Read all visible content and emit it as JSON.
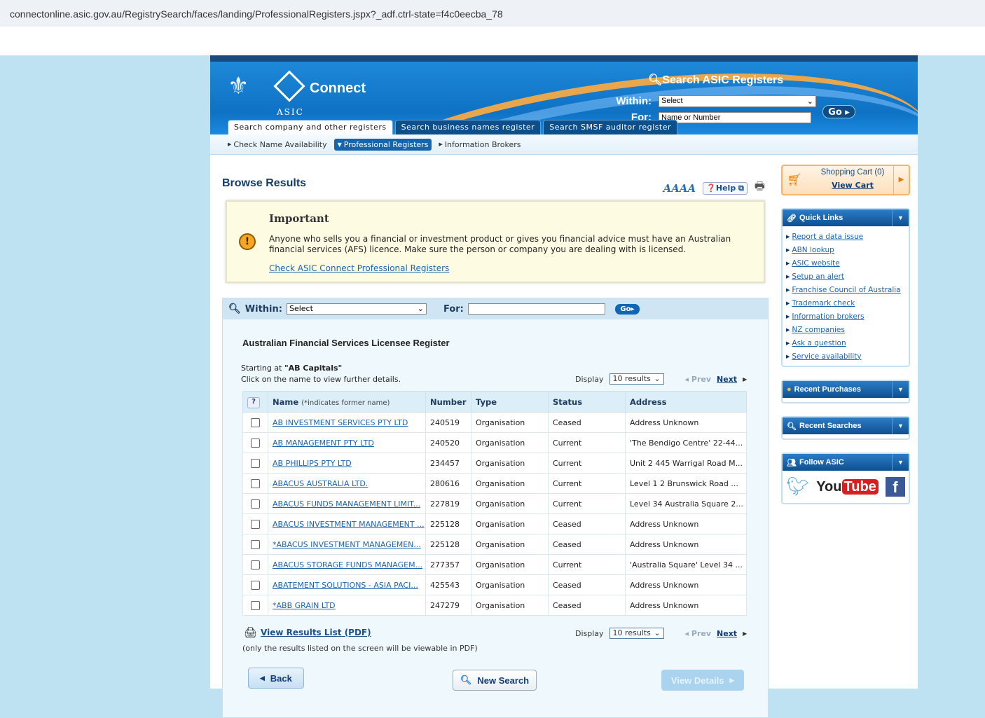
{
  "browser": {
    "url": "connectonline.asic.gov.au/RegistrySearch/faces/landing/ProfessionalRegisters.jspx?_adf.ctrl-state=f4c0eecba_78"
  },
  "header": {
    "brand": "Connect",
    "agency": "ASIC",
    "search_title": "Search ASIC Registers",
    "within_label": "Within:",
    "within_value": "Select",
    "for_label": "For:",
    "for_placeholder": "Name or Number",
    "go": "Go",
    "tabs": [
      "Search company and other registers",
      "Search business names register",
      "Search SMSF auditor register"
    ]
  },
  "subnav": [
    "Check Name Availability",
    "Professional Registers",
    "Information Brokers"
  ],
  "main": {
    "title": "Browse Results",
    "font_sizes": "AAAA",
    "help": "Help",
    "important": {
      "title": "Important",
      "text": "Anyone who sells you a financial or investment product or gives you financial advice must have an Australian financial services (AFS) licence. Make sure the person or company you are dealing with is licensed.",
      "link": "Check ASIC Connect Professional Registers"
    },
    "search": {
      "within_label": "Within:",
      "within_value": "Select",
      "for_label": "For:",
      "go": "Go"
    },
    "register_title": "Australian Financial Services Licensee Register",
    "starting_label": "Starting at",
    "starting_value": "\"AB Capitals\"",
    "instruction": "Click on the name to view further details.",
    "display_label": "Display",
    "display_value": "10 results",
    "prev": "Prev",
    "next": "Next",
    "columns": {
      "help": "?",
      "name": "Name",
      "name_note": "(*indicates former name)",
      "number": "Number",
      "type": "Type",
      "status": "Status",
      "address": "Address"
    },
    "rows": [
      {
        "name": "AB INVESTMENT SERVICES PTY LTD",
        "number": "240519",
        "type": "Organisation",
        "status": "Ceased",
        "address": "Address Unknown"
      },
      {
        "name": "AB MANAGEMENT PTY LTD",
        "number": "240520",
        "type": "Organisation",
        "status": "Current",
        "address": "'The Bendigo Centre' 22-44..."
      },
      {
        "name": "AB PHILLIPS PTY LTD",
        "number": "234457",
        "type": "Organisation",
        "status": "Current",
        "address": "Unit 2 445 Warrigal Road M..."
      },
      {
        "name": "ABACUS AUSTRALIA LTD.",
        "number": "280616",
        "type": "Organisation",
        "status": "Current",
        "address": "Level 1 2 Brunswick Road ..."
      },
      {
        "name": "ABACUS FUNDS MANAGEMENT LIMIT...",
        "number": "227819",
        "type": "Organisation",
        "status": "Current",
        "address": "Level 34 Australia Square 2..."
      },
      {
        "name": "ABACUS INVESTMENT MANAGEMENT ...",
        "number": "225128",
        "type": "Organisation",
        "status": "Ceased",
        "address": "Address Unknown"
      },
      {
        "name": "*ABACUS INVESTMENT MANAGEMEN...",
        "number": "225128",
        "type": "Organisation",
        "status": "Ceased",
        "address": "Address Unknown"
      },
      {
        "name": "ABACUS STORAGE FUNDS MANAGEM...",
        "number": "277357",
        "type": "Organisation",
        "status": "Current",
        "address": "'Australia Square' Level 34 ..."
      },
      {
        "name": "ABATEMENT SOLUTIONS - ASIA PACI...",
        "number": "425543",
        "type": "Organisation",
        "status": "Ceased",
        "address": "Address Unknown"
      },
      {
        "name": "*ABB GRAIN LTD",
        "number": "247279",
        "type": "Organisation",
        "status": "Ceased",
        "address": "Address Unknown"
      }
    ],
    "pdf_link": "View Results List (PDF)",
    "pdf_note": "(only the results listed on the screen will be viewable in PDF)",
    "back": "Back",
    "new_search": "New Search",
    "view_details": "View Details"
  },
  "sidebar": {
    "cart_title": "Shopping Cart (0)",
    "view_cart": "View Cart",
    "quick_links_title": "Quick Links",
    "quick_links": [
      "Report a data issue",
      "ABN lookup",
      "ASIC website",
      "Setup an alert",
      "Franchise Council of Australia",
      "Trademark check",
      "Information brokers",
      "NZ companies",
      "Ask a question",
      "Service availability"
    ],
    "recent_purchases": "Recent Purchases",
    "recent_searches": "Recent Searches",
    "follow": "Follow ASIC",
    "youtube_you": "You",
    "youtube_tube": "Tube"
  }
}
